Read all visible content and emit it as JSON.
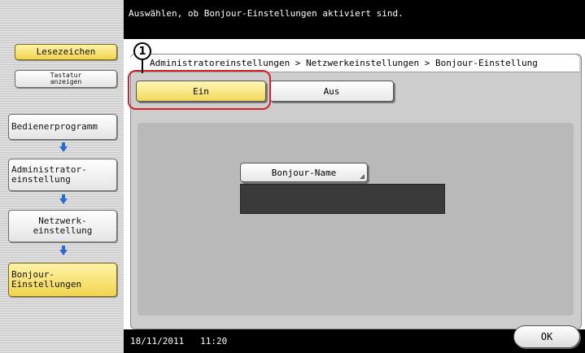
{
  "header": {
    "message": "Auswählen, ob Bonjour-Einstellungen aktiviert sind."
  },
  "sidebar": {
    "bookmark": "Lesezeichen",
    "show_keypad": "Tastatur\nanzeigen",
    "steps": [
      {
        "label": "Bedienerprogramm"
      },
      {
        "label": "Administrator-\neinstellung"
      },
      {
        "label": "Netzwerk-\neinstellung"
      },
      {
        "label": "Bonjour-\nEinstellungen"
      }
    ]
  },
  "main": {
    "breadcrumb": "Administratoreinstellungen > Netzwerkeinstellungen > Bonjour-Einstellung",
    "on_label": "Ein",
    "off_label": "Aus",
    "selected": "Ein",
    "bonjour_name_label": "Bonjour-Name",
    "bonjour_name_value": ""
  },
  "annotation": {
    "callout_number": "1",
    "highlight_color": "#d4202a"
  },
  "footer": {
    "datetime": "18/11/2011   11:20",
    "ok_label": "OK"
  },
  "colors": {
    "accent_yellow": "#f2d95b",
    "arrow_blue": "#2a6bd1"
  }
}
